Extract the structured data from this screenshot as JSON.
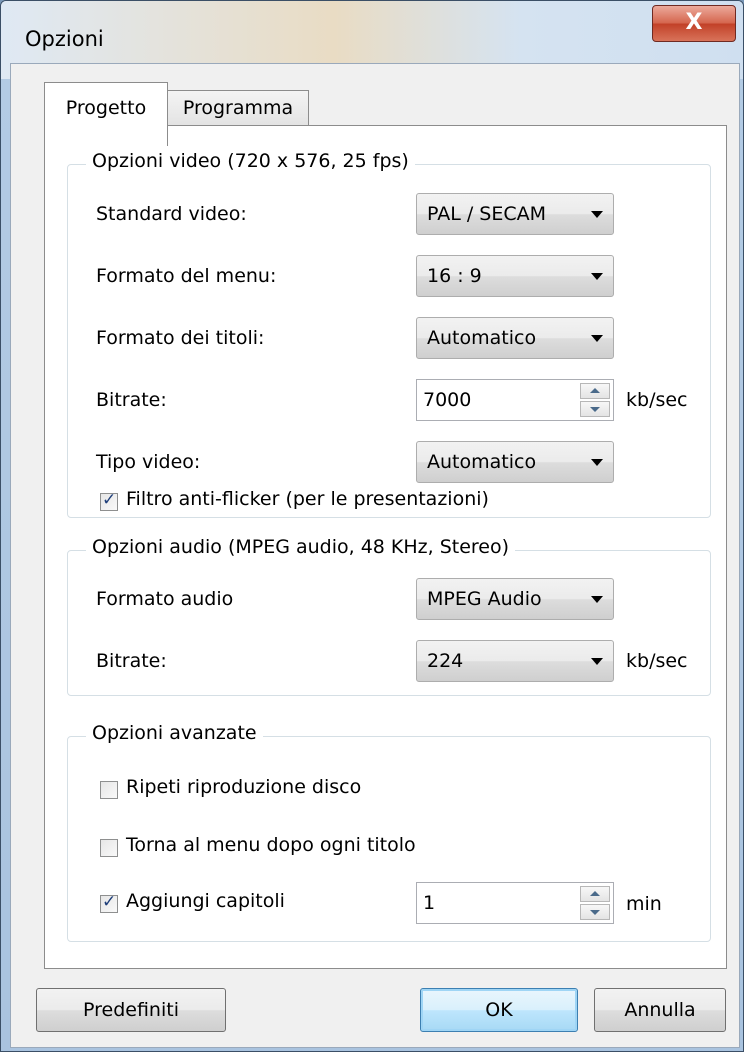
{
  "window": {
    "title": "Opzioni",
    "close_glyph": "X"
  },
  "tabs": [
    {
      "label": "Progetto",
      "active": true
    },
    {
      "label": "Programma",
      "active": false
    }
  ],
  "video": {
    "legend": "Opzioni video (720 x 576, 25 fps)",
    "standard_label": "Standard video:",
    "standard_value": "PAL / SECAM",
    "menu_format_label": "Formato del menu:",
    "menu_format_value": "16 : 9",
    "title_format_label": "Formato dei titoli:",
    "title_format_value": "Automatico",
    "bitrate_label": "Bitrate:",
    "bitrate_value": "7000",
    "bitrate_unit": "kb/sec",
    "type_label": "Tipo video:",
    "type_value": "Automatico",
    "antiflicker_label": "Filtro anti-flicker (per le presentazioni)",
    "antiflicker_checked": true
  },
  "audio": {
    "legend": "Opzioni audio (MPEG audio, 48 KHz, Stereo)",
    "format_label": "Formato audio",
    "format_value": "MPEG Audio",
    "bitrate_label": "Bitrate:",
    "bitrate_value": "224",
    "bitrate_unit": "kb/sec"
  },
  "advanced": {
    "legend": "Opzioni avanzate",
    "repeat_label": "Ripeti riproduzione disco",
    "repeat_checked": false,
    "return_menu_label": "Torna al menu dopo ogni titolo",
    "return_menu_checked": false,
    "chapters_label": "Aggiungi capitoli",
    "chapters_checked": true,
    "chapters_value": "1",
    "chapters_unit": "min"
  },
  "buttons": {
    "defaults": "Predefiniti",
    "ok": "OK",
    "cancel": "Annulla"
  },
  "check_glyph": "✓"
}
